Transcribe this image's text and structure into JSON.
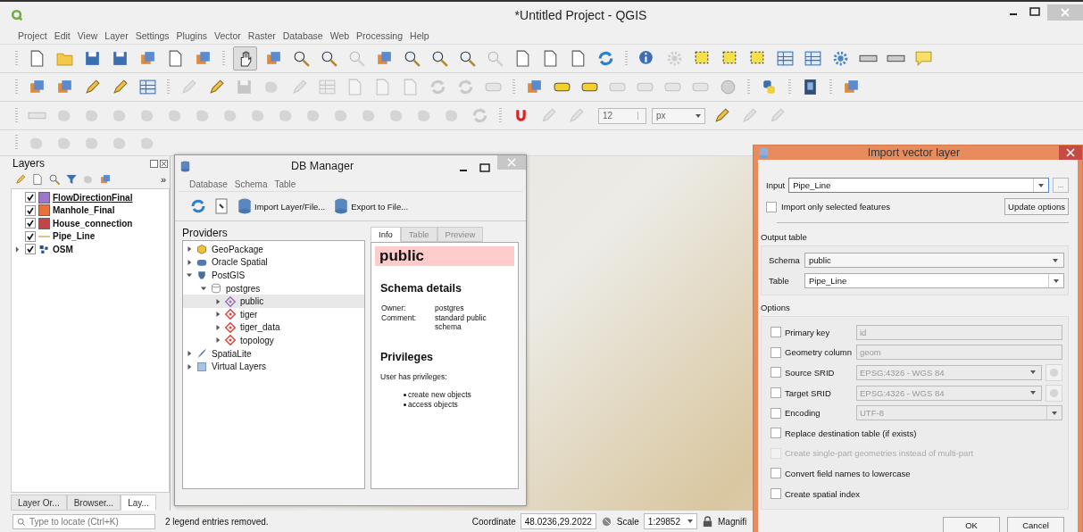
{
  "window": {
    "title": "*Untitled Project - QGIS"
  },
  "menu": [
    "Project",
    "Edit",
    "View",
    "Layer",
    "Settings",
    "Plugins",
    "Vector",
    "Raster",
    "Database",
    "Web",
    "Processing",
    "Help"
  ],
  "toolbars": [
    {
      "items": [
        {
          "kind": "button",
          "disabled": false,
          "active": false
        },
        {
          "kind": "button",
          "disabled": false,
          "active": false
        },
        {
          "kind": "button",
          "disabled": false,
          "active": false
        },
        {
          "kind": "button",
          "disabled": false,
          "active": false
        },
        {
          "kind": "button",
          "disabled": false,
          "active": false
        },
        {
          "kind": "button",
          "disabled": false,
          "active": false
        },
        {
          "kind": "button",
          "disabled": false,
          "active": false
        },
        {
          "kind": "separator"
        },
        {
          "kind": "button",
          "disabled": false,
          "active": true
        },
        {
          "kind": "button",
          "disabled": false,
          "active": false
        },
        {
          "kind": "button",
          "disabled": false,
          "active": false
        },
        {
          "kind": "button",
          "disabled": false,
          "active": false
        },
        {
          "kind": "button",
          "disabled": true,
          "active": false
        },
        {
          "kind": "button",
          "disabled": false,
          "active": false
        },
        {
          "kind": "button",
          "disabled": false,
          "active": false
        },
        {
          "kind": "button",
          "disabled": false,
          "active": false
        },
        {
          "kind": "button",
          "disabled": false,
          "active": false
        },
        {
          "kind": "button",
          "disabled": true,
          "active": false
        },
        {
          "kind": "button",
          "disabled": false,
          "active": false
        },
        {
          "kind": "button",
          "disabled": false,
          "active": false
        },
        {
          "kind": "button",
          "disabled": false,
          "active": false
        },
        {
          "kind": "button",
          "disabled": false,
          "active": false
        },
        {
          "kind": "separator"
        },
        {
          "kind": "button",
          "disabled": false,
          "active": false
        },
        {
          "kind": "button",
          "disabled": true,
          "active": false
        },
        {
          "kind": "button",
          "disabled": false,
          "active": false
        },
        {
          "kind": "button",
          "disabled": false,
          "active": false
        },
        {
          "kind": "button",
          "disabled": false,
          "active": false
        },
        {
          "kind": "button",
          "disabled": false,
          "active": false
        },
        {
          "kind": "button",
          "disabled": false,
          "active": false
        },
        {
          "kind": "button",
          "disabled": false,
          "active": false
        },
        {
          "kind": "button",
          "disabled": false,
          "active": false
        },
        {
          "kind": "button",
          "disabled": false,
          "active": false
        },
        {
          "kind": "button",
          "disabled": false,
          "active": false
        }
      ]
    },
    {
      "items": [
        {
          "kind": "button",
          "disabled": false,
          "active": false
        },
        {
          "kind": "button",
          "disabled": false,
          "active": false
        },
        {
          "kind": "button",
          "disabled": false,
          "active": false
        },
        {
          "kind": "button",
          "disabled": false,
          "active": false
        },
        {
          "kind": "button",
          "disabled": false,
          "active": false
        },
        {
          "kind": "separator"
        },
        {
          "kind": "button",
          "disabled": true,
          "active": false
        },
        {
          "kind": "button",
          "disabled": false,
          "active": false
        },
        {
          "kind": "button",
          "disabled": true,
          "active": false
        },
        {
          "kind": "button",
          "disabled": true,
          "active": false
        },
        {
          "kind": "button",
          "disabled": true,
          "active": false
        },
        {
          "kind": "button",
          "disabled": true,
          "active": false
        },
        {
          "kind": "button",
          "disabled": true,
          "active": false
        },
        {
          "kind": "button",
          "disabled": true,
          "active": false
        },
        {
          "kind": "button",
          "disabled": true,
          "active": false
        },
        {
          "kind": "button",
          "disabled": true,
          "active": false
        },
        {
          "kind": "button",
          "disabled": true,
          "active": false
        },
        {
          "kind": "button",
          "disabled": true,
          "active": false
        },
        {
          "kind": "separator"
        },
        {
          "kind": "button",
          "disabled": false,
          "active": false
        },
        {
          "kind": "button",
          "disabled": false,
          "active": false
        },
        {
          "kind": "button",
          "disabled": false,
          "active": false
        },
        {
          "kind": "button",
          "disabled": true,
          "active": false
        },
        {
          "kind": "button",
          "disabled": true,
          "active": false
        },
        {
          "kind": "button",
          "disabled": true,
          "active": false
        },
        {
          "kind": "button",
          "disabled": true,
          "active": false
        },
        {
          "kind": "button",
          "disabled": true,
          "active": false
        },
        {
          "kind": "separator"
        },
        {
          "kind": "button",
          "disabled": false,
          "active": false
        },
        {
          "kind": "separator"
        },
        {
          "kind": "button",
          "disabled": false,
          "active": false
        },
        {
          "kind": "separator"
        },
        {
          "kind": "button",
          "disabled": false,
          "active": false
        }
      ]
    },
    {
      "items": [
        {
          "kind": "button",
          "disabled": true,
          "active": false
        },
        {
          "kind": "button",
          "disabled": true,
          "active": false
        },
        {
          "kind": "button",
          "disabled": true,
          "active": false
        },
        {
          "kind": "button",
          "disabled": true,
          "active": false
        },
        {
          "kind": "button",
          "disabled": true,
          "active": false
        },
        {
          "kind": "button",
          "disabled": true,
          "active": false
        },
        {
          "kind": "button",
          "disabled": true,
          "active": false
        },
        {
          "kind": "button",
          "disabled": true,
          "active": false
        },
        {
          "kind": "button",
          "disabled": true,
          "active": false
        },
        {
          "kind": "button",
          "disabled": true,
          "active": false
        },
        {
          "kind": "button",
          "disabled": true,
          "active": false
        },
        {
          "kind": "button",
          "disabled": true,
          "active": false
        },
        {
          "kind": "button",
          "disabled": true,
          "active": false
        },
        {
          "kind": "button",
          "disabled": true,
          "active": false
        },
        {
          "kind": "button",
          "disabled": true,
          "active": false
        },
        {
          "kind": "button",
          "disabled": true,
          "active": false
        },
        {
          "kind": "button",
          "disabled": true,
          "active": false
        },
        {
          "kind": "separator"
        },
        {
          "kind": "button",
          "disabled": false,
          "active": false
        },
        {
          "kind": "button",
          "disabled": true,
          "active": false
        },
        {
          "kind": "button",
          "disabled": true,
          "active": false
        },
        {
          "kind": "spin",
          "value": "12"
        },
        {
          "kind": "combo",
          "value": "px"
        },
        {
          "kind": "button",
          "disabled": false,
          "active": false
        },
        {
          "kind": "button",
          "disabled": true,
          "active": false
        },
        {
          "kind": "button",
          "disabled": true,
          "active": false
        }
      ]
    },
    {
      "items": [
        {
          "kind": "button",
          "disabled": true,
          "active": false
        },
        {
          "kind": "button",
          "disabled": true,
          "active": false
        },
        {
          "kind": "button",
          "disabled": true,
          "active": false
        },
        {
          "kind": "button",
          "disabled": true,
          "active": false
        },
        {
          "kind": "button",
          "disabled": true,
          "active": false
        }
      ]
    }
  ],
  "layers_panel": {
    "title": "Layers",
    "more": "»",
    "layers": [
      {
        "name": "FlowDirectionFinal",
        "kind": "polygon",
        "color": "#9c77c6",
        "checked": true,
        "underlined": true
      },
      {
        "name": "Manhole_Final",
        "kind": "polygon",
        "color": "#e8703f",
        "checked": true,
        "underlined": false
      },
      {
        "name": "House_connection",
        "kind": "polygon",
        "color": "#c5434a",
        "checked": true,
        "underlined": false
      },
      {
        "name": "Pipe_Line",
        "kind": "line",
        "color": "#e6c27a",
        "checked": true,
        "underlined": false
      },
      {
        "name": "OSM",
        "kind": "raster",
        "color": "#2e4f8a",
        "checked": true,
        "underlined": false
      }
    ],
    "tabs": [
      {
        "label": "Layer Or...",
        "selected": false
      },
      {
        "label": "Browser...",
        "selected": false
      },
      {
        "label": "Lay...",
        "selected": true
      }
    ]
  },
  "db_manager": {
    "title": "DB Manager",
    "menu": [
      "Database",
      "Schema",
      "Table"
    ],
    "import_button": "Import Layer/File...",
    "export_button": "Export to File...",
    "providers_title": "Providers",
    "tree": [
      {
        "label": "GeoPackage",
        "kind": "geopackage",
        "expanded": false,
        "selected": false
      },
      {
        "label": "Oracle Spatial",
        "kind": "oracle",
        "expanded": false,
        "selected": false
      },
      {
        "label": "PostGIS",
        "kind": "postgis",
        "expanded": true,
        "selected": false,
        "children": [
          {
            "label": "postgres",
            "kind": "connection",
            "expanded": true,
            "selected": false,
            "children": [
              {
                "label": "public",
                "kind": "schema",
                "color": "#9c6bb8",
                "expanded": false,
                "selected": true
              },
              {
                "label": "tiger",
                "kind": "schema",
                "color": "#d9433b",
                "expanded": false,
                "selected": false
              },
              {
                "label": "tiger_data",
                "kind": "schema",
                "color": "#d9433b",
                "expanded": false,
                "selected": false
              },
              {
                "label": "topology",
                "kind": "schema",
                "color": "#d9433b",
                "expanded": false,
                "selected": false
              }
            ]
          }
        ]
      },
      {
        "label": "SpatiaLite",
        "kind": "spatialite",
        "expanded": false,
        "selected": false
      },
      {
        "label": "Virtual Layers",
        "kind": "virtual",
        "expanded": false,
        "selected": false
      }
    ],
    "tabs": [
      {
        "label": "Info",
        "selected": true
      },
      {
        "label": "Table",
        "selected": false
      },
      {
        "label": "Preview",
        "selected": false
      }
    ],
    "info": {
      "heading": "public",
      "details_title": "Schema details",
      "details": [
        {
          "label": "Owner:",
          "value": "postgres"
        },
        {
          "label": "Comment:",
          "value": "standard public schema"
        }
      ],
      "privileges_title": "Privileges",
      "privileges_text": "User has privileges:",
      "privileges": [
        "create new objects",
        "access objects"
      ]
    }
  },
  "import_dialog": {
    "title": "Import vector layer",
    "input_label": "Input",
    "input_value": "Pipe_Line",
    "browse": "...",
    "only_selected": {
      "label": "Import only selected features",
      "checked": false
    },
    "update_button": "Update options",
    "output_title": "Output table",
    "schema_label": "Schema",
    "schema_value": "public",
    "table_label": "Table",
    "table_value": "Pipe_Line",
    "options_title": "Options",
    "options": [
      {
        "kind": "text",
        "label": "Primary key",
        "value": "id",
        "checked": false,
        "disabled": false
      },
      {
        "kind": "text",
        "label": "Geometry column",
        "value": "geom",
        "checked": false,
        "disabled": false
      },
      {
        "kind": "crs",
        "label": "Source SRID",
        "value": "EPSG:4326 - WGS 84",
        "checked": false,
        "disabled": false
      },
      {
        "kind": "crs",
        "label": "Target SRID",
        "value": "EPSG:4326 - WGS 84",
        "checked": false,
        "disabled": false
      },
      {
        "kind": "combo",
        "label": "Encoding",
        "value": "UTF-8",
        "checked": false,
        "disabled": false
      },
      {
        "kind": "check",
        "label": "Replace destination table (if exists)",
        "checked": false,
        "disabled": false
      },
      {
        "kind": "check",
        "label": "Create single-part geometries instead of multi-part",
        "checked": false,
        "disabled": true
      },
      {
        "kind": "check",
        "label": "Convert field names to lowercase",
        "checked": false,
        "disabled": false
      },
      {
        "kind": "check",
        "label": "Create spatial index",
        "checked": false,
        "disabled": false
      }
    ],
    "buttons": [
      "OK",
      "Cancel"
    ]
  },
  "status_bar": {
    "locator_placeholder": "Type to locate (Ctrl+K)",
    "message": "2 legend entries removed.",
    "coordinate_label": "Coordinate",
    "coordinate": "48.0236,29.2022",
    "scale_label": "Scale",
    "scale": "1:29852",
    "magnifier_label": "Magnifi"
  }
}
